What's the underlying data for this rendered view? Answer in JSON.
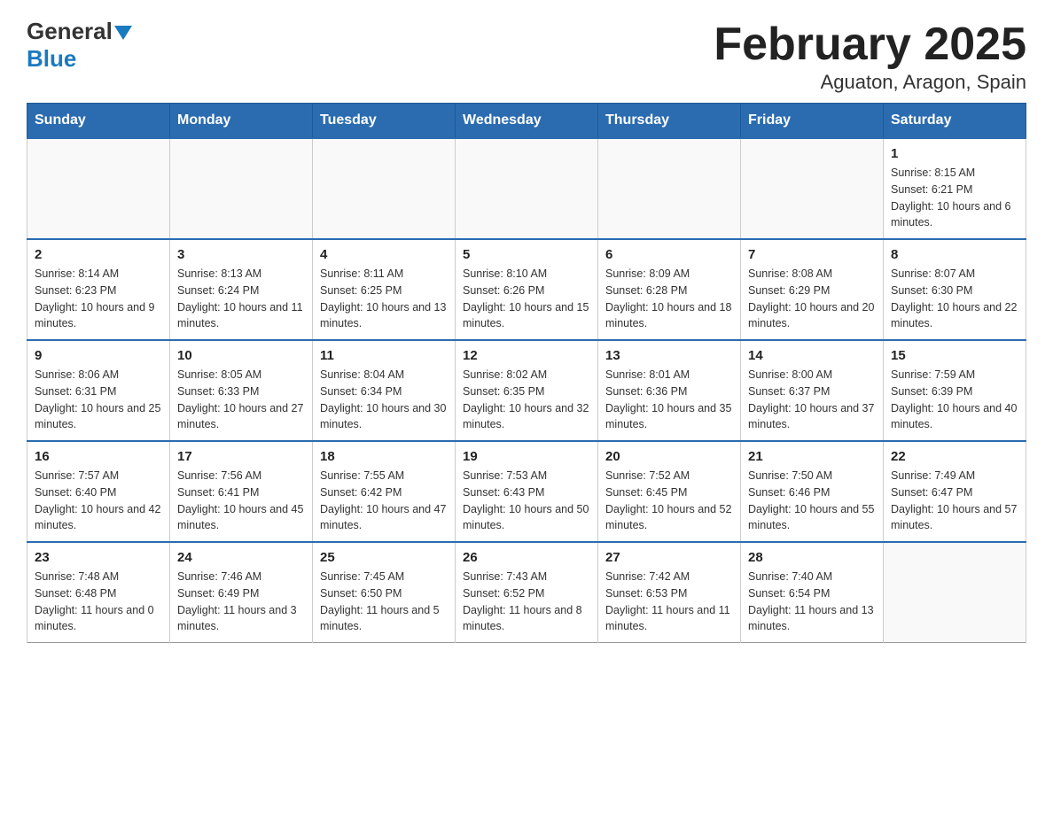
{
  "header": {
    "logo": {
      "general": "General",
      "blue": "Blue",
      "arrow": "▼"
    },
    "title": "February 2025",
    "subtitle": "Aguaton, Aragon, Spain"
  },
  "weekdays": [
    "Sunday",
    "Monday",
    "Tuesday",
    "Wednesday",
    "Thursday",
    "Friday",
    "Saturday"
  ],
  "weeks": [
    [
      {
        "day": "",
        "info": ""
      },
      {
        "day": "",
        "info": ""
      },
      {
        "day": "",
        "info": ""
      },
      {
        "day": "",
        "info": ""
      },
      {
        "day": "",
        "info": ""
      },
      {
        "day": "",
        "info": ""
      },
      {
        "day": "1",
        "info": "Sunrise: 8:15 AM\nSunset: 6:21 PM\nDaylight: 10 hours and 6 minutes."
      }
    ],
    [
      {
        "day": "2",
        "info": "Sunrise: 8:14 AM\nSunset: 6:23 PM\nDaylight: 10 hours and 9 minutes."
      },
      {
        "day": "3",
        "info": "Sunrise: 8:13 AM\nSunset: 6:24 PM\nDaylight: 10 hours and 11 minutes."
      },
      {
        "day": "4",
        "info": "Sunrise: 8:11 AM\nSunset: 6:25 PM\nDaylight: 10 hours and 13 minutes."
      },
      {
        "day": "5",
        "info": "Sunrise: 8:10 AM\nSunset: 6:26 PM\nDaylight: 10 hours and 15 minutes."
      },
      {
        "day": "6",
        "info": "Sunrise: 8:09 AM\nSunset: 6:28 PM\nDaylight: 10 hours and 18 minutes."
      },
      {
        "day": "7",
        "info": "Sunrise: 8:08 AM\nSunset: 6:29 PM\nDaylight: 10 hours and 20 minutes."
      },
      {
        "day": "8",
        "info": "Sunrise: 8:07 AM\nSunset: 6:30 PM\nDaylight: 10 hours and 22 minutes."
      }
    ],
    [
      {
        "day": "9",
        "info": "Sunrise: 8:06 AM\nSunset: 6:31 PM\nDaylight: 10 hours and 25 minutes."
      },
      {
        "day": "10",
        "info": "Sunrise: 8:05 AM\nSunset: 6:33 PM\nDaylight: 10 hours and 27 minutes."
      },
      {
        "day": "11",
        "info": "Sunrise: 8:04 AM\nSunset: 6:34 PM\nDaylight: 10 hours and 30 minutes."
      },
      {
        "day": "12",
        "info": "Sunrise: 8:02 AM\nSunset: 6:35 PM\nDaylight: 10 hours and 32 minutes."
      },
      {
        "day": "13",
        "info": "Sunrise: 8:01 AM\nSunset: 6:36 PM\nDaylight: 10 hours and 35 minutes."
      },
      {
        "day": "14",
        "info": "Sunrise: 8:00 AM\nSunset: 6:37 PM\nDaylight: 10 hours and 37 minutes."
      },
      {
        "day": "15",
        "info": "Sunrise: 7:59 AM\nSunset: 6:39 PM\nDaylight: 10 hours and 40 minutes."
      }
    ],
    [
      {
        "day": "16",
        "info": "Sunrise: 7:57 AM\nSunset: 6:40 PM\nDaylight: 10 hours and 42 minutes."
      },
      {
        "day": "17",
        "info": "Sunrise: 7:56 AM\nSunset: 6:41 PM\nDaylight: 10 hours and 45 minutes."
      },
      {
        "day": "18",
        "info": "Sunrise: 7:55 AM\nSunset: 6:42 PM\nDaylight: 10 hours and 47 minutes."
      },
      {
        "day": "19",
        "info": "Sunrise: 7:53 AM\nSunset: 6:43 PM\nDaylight: 10 hours and 50 minutes."
      },
      {
        "day": "20",
        "info": "Sunrise: 7:52 AM\nSunset: 6:45 PM\nDaylight: 10 hours and 52 minutes."
      },
      {
        "day": "21",
        "info": "Sunrise: 7:50 AM\nSunset: 6:46 PM\nDaylight: 10 hours and 55 minutes."
      },
      {
        "day": "22",
        "info": "Sunrise: 7:49 AM\nSunset: 6:47 PM\nDaylight: 10 hours and 57 minutes."
      }
    ],
    [
      {
        "day": "23",
        "info": "Sunrise: 7:48 AM\nSunset: 6:48 PM\nDaylight: 11 hours and 0 minutes."
      },
      {
        "day": "24",
        "info": "Sunrise: 7:46 AM\nSunset: 6:49 PM\nDaylight: 11 hours and 3 minutes."
      },
      {
        "day": "25",
        "info": "Sunrise: 7:45 AM\nSunset: 6:50 PM\nDaylight: 11 hours and 5 minutes."
      },
      {
        "day": "26",
        "info": "Sunrise: 7:43 AM\nSunset: 6:52 PM\nDaylight: 11 hours and 8 minutes."
      },
      {
        "day": "27",
        "info": "Sunrise: 7:42 AM\nSunset: 6:53 PM\nDaylight: 11 hours and 11 minutes."
      },
      {
        "day": "28",
        "info": "Sunrise: 7:40 AM\nSunset: 6:54 PM\nDaylight: 11 hours and 13 minutes."
      },
      {
        "day": "",
        "info": ""
      }
    ]
  ]
}
